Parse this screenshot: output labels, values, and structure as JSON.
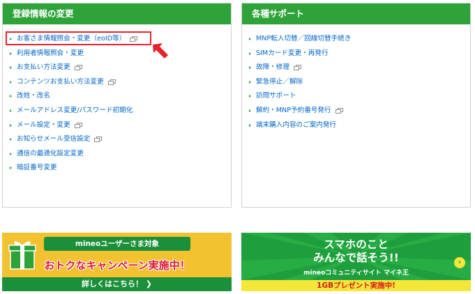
{
  "registration": {
    "title": "登録情報の変更",
    "items": [
      {
        "label": "お客さま情報照会・変更（eoID等）",
        "ext": true
      },
      {
        "label": "利用者情報照会・変更",
        "ext": false
      },
      {
        "label": "お支払い方法変更",
        "ext": true
      },
      {
        "label": "コンテンツお支払い方法変更",
        "ext": true
      },
      {
        "label": "改姓・改名",
        "ext": false
      },
      {
        "label": "メールアドレス変更/パスワード初期化",
        "ext": false
      },
      {
        "label": "メール設定・変更",
        "ext": true
      },
      {
        "label": "お知らせメール受信設定",
        "ext": true
      },
      {
        "label": "通信の最適化設定変更",
        "ext": false
      },
      {
        "label": "暗証番号変更",
        "ext": false
      }
    ]
  },
  "support": {
    "title": "各種サポート",
    "items": [
      {
        "label": "MNP転入切替／回線切替手続き",
        "ext": false
      },
      {
        "label": "SIMカード変更・再発行",
        "ext": false
      },
      {
        "label": "故障・修理",
        "ext": true
      },
      {
        "label": "緊急停止／解除",
        "ext": false
      },
      {
        "label": "訪問サポート",
        "ext": false
      },
      {
        "label": "解約・MNP予約番号発行",
        "ext": true
      },
      {
        "label": "端末購入内容のご案内発行",
        "ext": false
      }
    ]
  },
  "banner_campaign": {
    "top": "mineoユーザーさま対象",
    "main": "おトクなキャンペーン実施中！",
    "cta": "詳しくはこちら！ ❯"
  },
  "banner_community": {
    "line1": "スマホのこと",
    "line2": "みんなで話そう!!",
    "sub": "mineoコミュニティサイト マイネ王",
    "bottom": "1GBプレゼント実施中!",
    "next": "›"
  },
  "colors": {
    "green": "#2ea339",
    "link": "#0066cc",
    "highlight": "#e8222a"
  }
}
